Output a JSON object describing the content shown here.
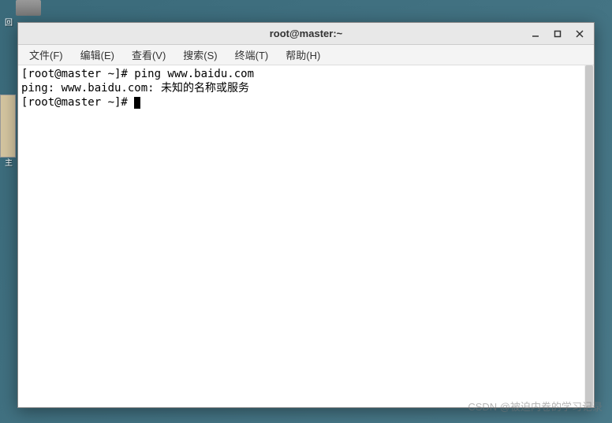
{
  "desktop": {
    "icon1_label": "回",
    "icon2_label": "主"
  },
  "window": {
    "title": "root@master:~"
  },
  "menu": {
    "file": "文件(F)",
    "edit": "编辑(E)",
    "view": "查看(V)",
    "search": "搜索(S)",
    "terminal": "终端(T)",
    "help": "帮助(H)"
  },
  "terminal": {
    "lines": {
      "0": "[root@master ~]# ping www.baidu.com",
      "1": "ping: www.baidu.com: 未知的名称或服务",
      "2": "[root@master ~]# "
    }
  },
  "watermark": "CSDN @被迫内卷的学习记录"
}
